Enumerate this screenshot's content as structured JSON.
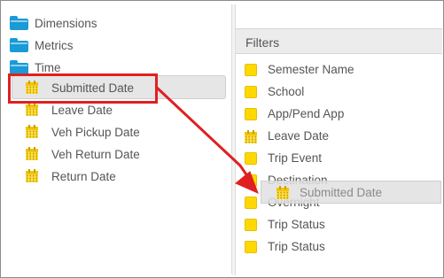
{
  "tree": {
    "folders": [
      {
        "label": "Dimensions",
        "icon": "folder-icon"
      },
      {
        "label": "Metrics",
        "icon": "folder-icon"
      },
      {
        "label": "Time",
        "icon": "folder-icon"
      }
    ],
    "time_items": [
      {
        "label": "Submitted Date",
        "icon": "calendar-icon",
        "selected": true
      },
      {
        "label": "Leave Date",
        "icon": "calendar-icon"
      },
      {
        "label": "Veh Pickup Date",
        "icon": "calendar-icon"
      },
      {
        "label": "Veh Return Date",
        "icon": "calendar-icon"
      },
      {
        "label": "Return Date",
        "icon": "calendar-icon"
      }
    ]
  },
  "filters": {
    "header": "Filters",
    "items": [
      {
        "label": "Semester Name",
        "icon": "square-icon"
      },
      {
        "label": "School",
        "icon": "square-icon"
      },
      {
        "label": "App/Pend App",
        "icon": "square-icon"
      },
      {
        "label": "Leave Date",
        "icon": "calendar-icon"
      },
      {
        "label": "Trip Event",
        "icon": "square-icon"
      },
      {
        "label": "Destination",
        "icon": "square-icon"
      },
      {
        "label": "Overnight",
        "icon": "square-icon"
      },
      {
        "label": "Trip Status",
        "icon": "square-icon"
      },
      {
        "label": "Trip Status",
        "icon": "square-icon"
      }
    ]
  },
  "drag_ghost": {
    "label": "Submitted Date",
    "icon": "calendar-icon"
  },
  "colors": {
    "folder": "#1a9ad6",
    "calendar": "#ffd800",
    "annotation": "#e02020",
    "selected_row": "#e6e6e6"
  }
}
